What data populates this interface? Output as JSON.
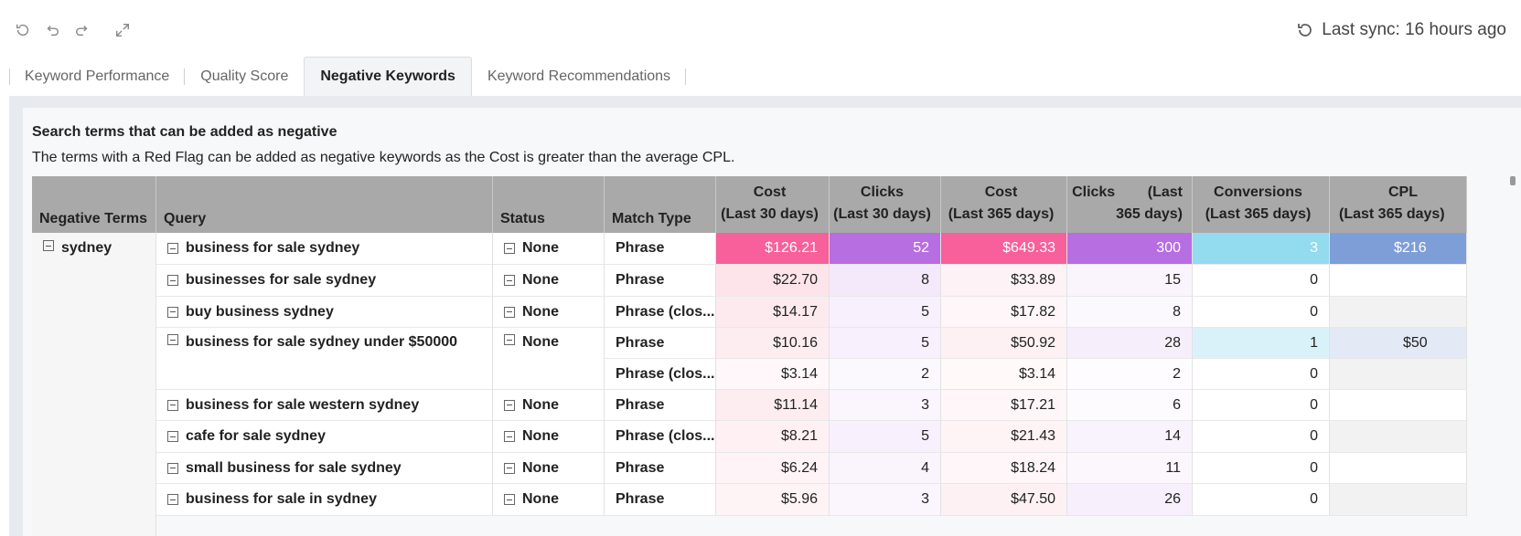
{
  "toolbar": {
    "icons": [
      "refresh-icon",
      "undo-icon",
      "redo-icon",
      "expand-icon"
    ],
    "sync_text": "Last sync: 16 hours ago"
  },
  "tabs": [
    {
      "label": "Keyword Performance",
      "active": false
    },
    {
      "label": "Quality Score",
      "active": false
    },
    {
      "label": "Negative Keywords",
      "active": true
    },
    {
      "label": "Keyword Recommendations",
      "active": false
    }
  ],
  "panel": {
    "title": "Search terms that can be added as negative",
    "description": "The terms with a Red Flag can be added as negative keywords as the Cost is greater than the average CPL."
  },
  "table": {
    "headers": {
      "negative_terms": "Negative Terms",
      "query": "Query",
      "status": "Status",
      "match_type": "Match Type",
      "cost30_l1": "Cost",
      "cost30_l2": "(Last 30 days)",
      "clicks30_l1": "Clicks",
      "clicks30_l2": "(Last 30 days)",
      "cost365_l1": "Cost",
      "cost365_l2": "(Last 365 days)",
      "clicks365_l1": "Clicks        (Last",
      "clicks365_l2": "365 days)",
      "conv365_l1": "Conversions",
      "conv365_l2": "(Last 365 days)",
      "cpl365_l1": "CPL",
      "cpl365_l2": "(Last 365 days)"
    },
    "negative_term": "sydney",
    "rows": [
      {
        "query": "business for sale sydney",
        "status": "None",
        "match": "Phrase",
        "cost30": "$126.21",
        "clicks30": "52",
        "cost365": "$649.33",
        "clicks365": "300",
        "conv": "3",
        "cpl": "$216"
      },
      {
        "query": "businesses for sale sydney",
        "status": "None",
        "match": "Phrase",
        "cost30": "$22.70",
        "clicks30": "8",
        "cost365": "$33.89",
        "clicks365": "15",
        "conv": "0",
        "cpl": ""
      },
      {
        "query": "buy business sydney",
        "status": "None",
        "match": "Phrase (clos...",
        "cost30": "$14.17",
        "clicks30": "5",
        "cost365": "$17.82",
        "clicks365": "8",
        "conv": "0",
        "cpl": ""
      },
      {
        "query": "business for sale sydney under $50000",
        "status": "None",
        "match": "Phrase",
        "cost30": "$10.16",
        "clicks30": "5",
        "cost365": "$50.92",
        "clicks365": "28",
        "conv": "1",
        "cpl": "$50"
      },
      {
        "query": "",
        "status": "",
        "match": "Phrase (clos...",
        "cost30": "$3.14",
        "clicks30": "2",
        "cost365": "$3.14",
        "clicks365": "2",
        "conv": "0",
        "cpl": ""
      },
      {
        "query": "business for sale western sydney",
        "status": "None",
        "match": "Phrase",
        "cost30": "$11.14",
        "clicks30": "3",
        "cost365": "$17.21",
        "clicks365": "6",
        "conv": "0",
        "cpl": ""
      },
      {
        "query": "cafe for sale sydney",
        "status": "None",
        "match": "Phrase (clos...",
        "cost30": "$8.21",
        "clicks30": "5",
        "cost365": "$21.43",
        "clicks365": "14",
        "conv": "0",
        "cpl": ""
      },
      {
        "query": "small business for sale sydney",
        "status": "None",
        "match": "Phrase",
        "cost30": "$6.24",
        "clicks30": "4",
        "cost365": "$18.24",
        "clicks365": "11",
        "conv": "0",
        "cpl": ""
      },
      {
        "query": "business for sale in sydney",
        "status": "None",
        "match": "Phrase",
        "cost30": "$5.96",
        "clicks30": "3",
        "cost365": "$47.50",
        "clicks365": "26",
        "conv": "0",
        "cpl": ""
      }
    ],
    "row_colors": [
      {
        "cost30": "#f7609a",
        "clicks30": "#b76ee0",
        "cost365": "#f7609a",
        "clicks365": "#b76ee0",
        "conv": "#93dbef",
        "cpl": "#7e9ed8",
        "white": true
      },
      {
        "cost30": "#fde4ea",
        "clicks30": "#f4e8fb",
        "cost365": "#fdf2f5",
        "clicks365": "#faf5fd",
        "conv": "#ffffff",
        "cpl": "#ffffff"
      },
      {
        "cost30": "#fdeaef",
        "clicks30": "#f8f0fd",
        "cost365": "#fef6f8",
        "clicks365": "#fcf9fe",
        "conv": "#ffffff",
        "cpl": "#f2f2f2"
      },
      {
        "cost30": "#fdedf1",
        "clicks30": "#f8f0fd",
        "cost365": "#fdf1f4",
        "clicks365": "#f6eefb",
        "conv": "#d9f2f9",
        "cpl": "#e3e9f5"
      },
      {
        "cost30": "#fff7f9",
        "clicks30": "#fcf9fe",
        "cost365": "#fff9fa",
        "clicks365": "#fefcff",
        "conv": "#ffffff",
        "cpl": "#f2f2f2"
      },
      {
        "cost30": "#fdecf0",
        "clicks30": "#fbf6fd",
        "cost365": "#fef6f8",
        "clicks365": "#fdfbfe",
        "conv": "#ffffff",
        "cpl": "#ffffff"
      },
      {
        "cost30": "#fef0f3",
        "clicks30": "#f8f0fd",
        "cost365": "#fef4f6",
        "clicks365": "#f9f3fd",
        "conv": "#ffffff",
        "cpl": "#f2f2f2"
      },
      {
        "cost30": "#fef3f6",
        "clicks30": "#faf4fd",
        "cost365": "#fef6f8",
        "clicks365": "#fbf7fd",
        "conv": "#ffffff",
        "cpl": "#ffffff"
      },
      {
        "cost30": "#fef4f6",
        "clicks30": "#fbf6fd",
        "cost365": "#fdf1f4",
        "clicks365": "#f7f0fc",
        "conv": "#ffffff",
        "cpl": "#f2f2f2"
      }
    ]
  }
}
